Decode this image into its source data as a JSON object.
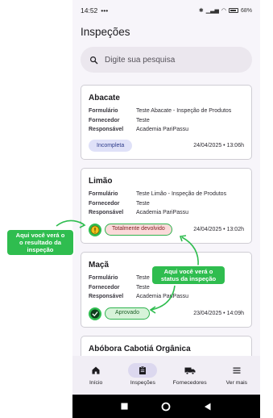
{
  "status": {
    "time": "14:52",
    "dots": "•••",
    "battery": "68%"
  },
  "page": {
    "title": "Inspeções"
  },
  "search": {
    "placeholder": "Digite sua pesquisa"
  },
  "field_labels": {
    "form": "Formulário",
    "supplier": "Fornecedor",
    "responsible": "Responsável"
  },
  "cards": [
    {
      "title": "Abacate",
      "form": "Teste Abacate - Inspeção de Produtos",
      "supplier": "Teste",
      "responsible": "Academia PariPassu",
      "status": "Incompleta",
      "date": "24/04/2025 • 13:06h"
    },
    {
      "title": "Limão",
      "form": "Teste Limão - Inspeção de Produtos",
      "supplier": "Teste",
      "responsible": "Academia PariPassu",
      "status": "Totalmente devolvido",
      "result": "warning",
      "date": "24/04/2025 • 13:02h"
    },
    {
      "title": "Maçã",
      "form": "Teste Maçã - Inspeção de Produtos",
      "supplier": "Teste",
      "responsible": "Academia PariPassu",
      "status": "Aprovado",
      "result": "approved",
      "date": "23/04/2025 • 14:09h"
    },
    {
      "title": "Abóbora Cabotiá Orgânica"
    }
  ],
  "nav": [
    {
      "label": "Início",
      "icon": "home-icon"
    },
    {
      "label": "Inspeções",
      "icon": "clipboard-icon",
      "active": true
    },
    {
      "label": "Fornecedores",
      "icon": "truck-icon"
    },
    {
      "label": "Ver mais",
      "icon": "menu-icon"
    }
  ],
  "annotations": {
    "result": "Aqui você verá o resultado da inspeção",
    "result_lines": [
      "Aqui você verá o",
      "o resultado da",
      "inspeção"
    ],
    "status_lines": [
      "Aqui você verá o",
      "status da inspeção"
    ]
  },
  "colors": {
    "accent_green": "#2fbd4f",
    "approved_bg": "#d7f3d9",
    "returned_bg": "#fbdada",
    "incomplete_bg": "#dfe1f8",
    "warning_yellow": "#f2c21b"
  }
}
